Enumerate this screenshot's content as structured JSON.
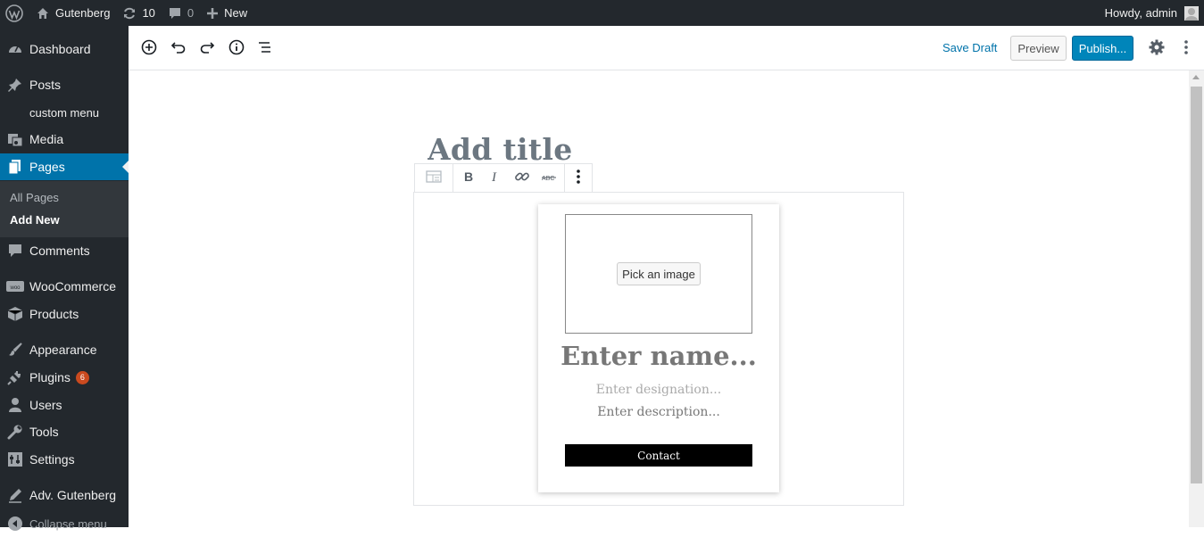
{
  "admin_bar": {
    "site_name": "Gutenberg",
    "updates_count": "10",
    "comments_count": "0",
    "new_label": "New",
    "howdy": "Howdy, admin"
  },
  "sidebar": {
    "items": [
      {
        "label": "Dashboard",
        "icon": "dashboard-icon"
      },
      {
        "label": "Posts",
        "icon": "pin-icon"
      },
      {
        "label": "custom menu"
      },
      {
        "label": "Media",
        "icon": "media-icon"
      },
      {
        "label": "Pages",
        "icon": "pages-icon",
        "active": true
      },
      {
        "label": "Comments",
        "icon": "comment-icon"
      },
      {
        "label": "WooCommerce",
        "icon": "woo-icon"
      },
      {
        "label": "Products",
        "icon": "box-icon"
      },
      {
        "label": "Appearance",
        "icon": "brush-icon"
      },
      {
        "label": "Plugins",
        "icon": "plug-icon",
        "badge": "6"
      },
      {
        "label": "Users",
        "icon": "user-icon"
      },
      {
        "label": "Tools",
        "icon": "wrench-icon"
      },
      {
        "label": "Settings",
        "icon": "settings-icon"
      },
      {
        "label": "Adv. Gutenberg",
        "icon": "pen-icon"
      }
    ],
    "submenu": [
      "All Pages",
      "Add New"
    ],
    "collapse_label": "Collapse menu"
  },
  "editor_header": {
    "save_draft": "Save Draft",
    "preview": "Preview",
    "publish": "Publish..."
  },
  "title_placeholder": "Add title",
  "profile_card": {
    "pick_image": "Pick an image",
    "name_placeholder": "Enter name...",
    "designation_placeholder": "Enter designation...",
    "description_placeholder": "Enter description...",
    "contact": "Contact"
  },
  "colors": {
    "admin_dark": "#23282d",
    "active_blue": "#0073aa",
    "publish_blue": "#0085ba",
    "badge_orange": "#ca4a1f"
  }
}
